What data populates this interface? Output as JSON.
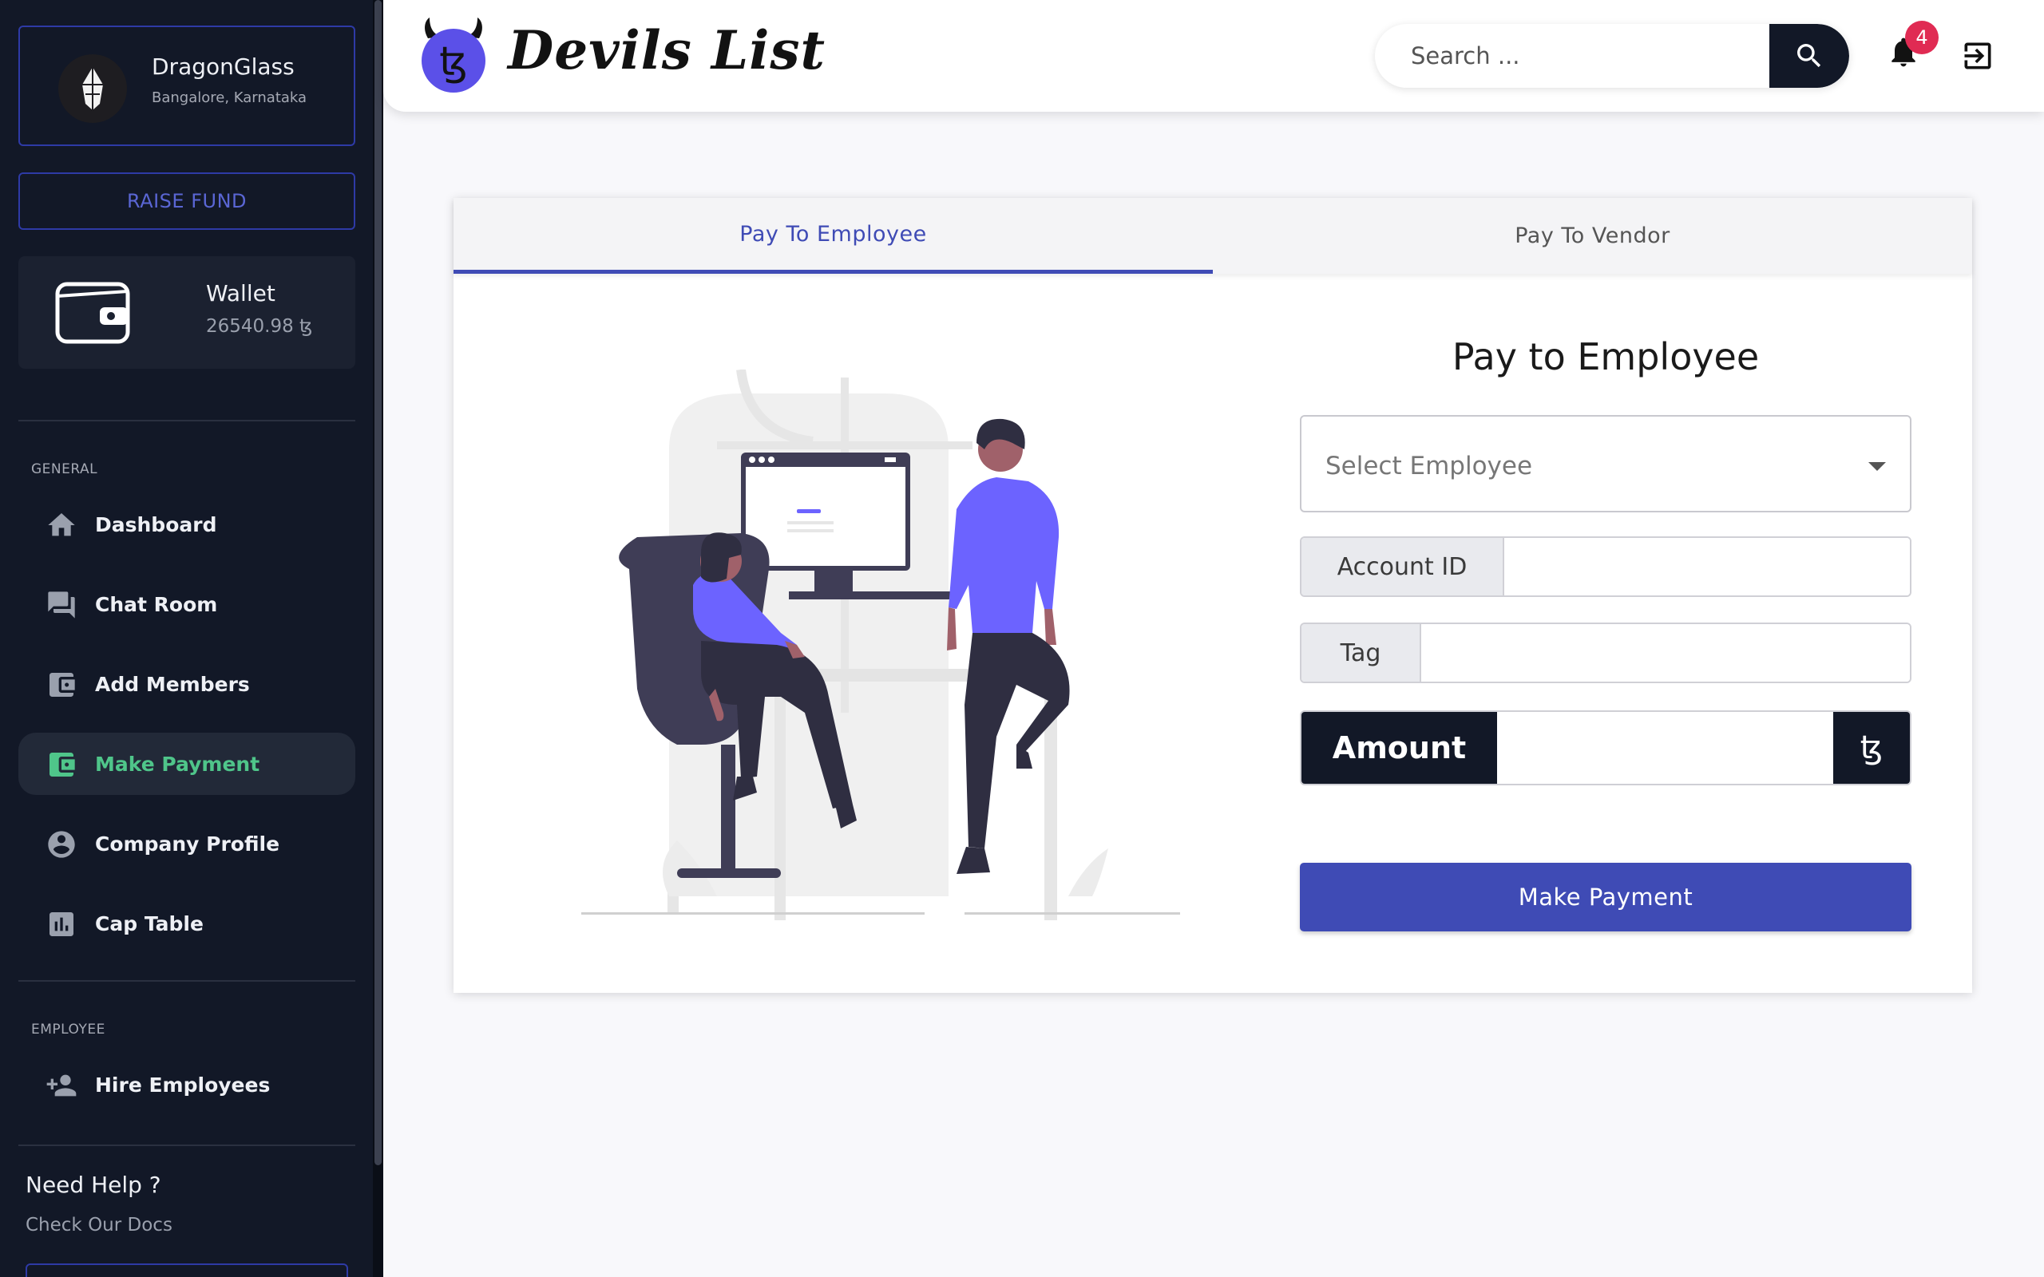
{
  "company": {
    "name": "DragonGlass",
    "location": "Bangalore, Karnataka"
  },
  "raise_fund_label": "RAISE FUND",
  "wallet": {
    "title": "Wallet",
    "amount": "26540.98 ꜩ"
  },
  "sidebar": {
    "general_label": "GENERAL",
    "employee_label": "EMPLOYEE",
    "items": [
      {
        "label": "Dashboard",
        "icon": "home-icon"
      },
      {
        "label": "Chat Room",
        "icon": "chat-icon"
      },
      {
        "label": "Add Members",
        "icon": "wallet-card-icon"
      },
      {
        "label": "Make Payment",
        "icon": "wallet-card-icon",
        "active": true
      },
      {
        "label": "Company Profile",
        "icon": "account-circle-icon"
      },
      {
        "label": "Cap Table",
        "icon": "bar-chart-icon"
      }
    ],
    "employee_items": [
      {
        "label": "Hire Employees",
        "icon": "person-add-icon"
      }
    ],
    "help": {
      "title": "Need Help ?",
      "link": "Check Our Docs"
    }
  },
  "header": {
    "brand": "Devils List",
    "logo_glyph": "ꜩ",
    "search_placeholder": "Search ...",
    "notifications": "4"
  },
  "tabs": [
    {
      "label": "Pay To Employee",
      "active": true
    },
    {
      "label": "Pay To Vendor",
      "active": false
    }
  ],
  "form": {
    "title": "Pay to Employee",
    "select_placeholder": "Select Employee",
    "account_label": "Account ID",
    "account_value": "",
    "tag_label": "Tag",
    "tag_value": "",
    "amount_label": "Amount",
    "amount_value": "",
    "currency": "ꜩ",
    "submit_label": "Make Payment"
  },
  "colors": {
    "sidebar_bg": "#121827",
    "accent": "#3f4bb5",
    "active_nav": "#4fc58a",
    "badge": "#e02b53",
    "illustration_purple": "#6c63ff"
  }
}
